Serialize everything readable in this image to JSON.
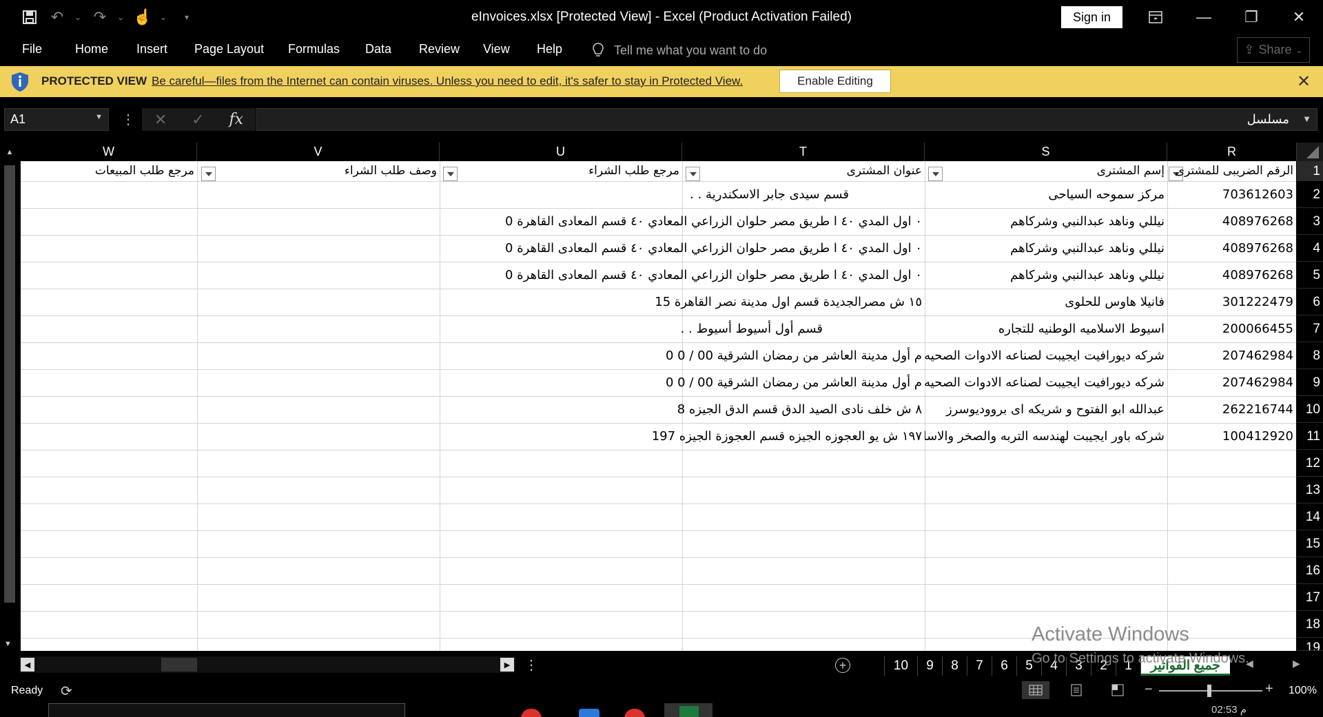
{
  "window": {
    "title": "eInvoices.xlsx  [Protected View]  -  Excel (Product Activation Failed)",
    "sign_in": "Sign in"
  },
  "ribbon": {
    "tabs": [
      "File",
      "Home",
      "Insert",
      "Page Layout",
      "Formulas",
      "Data",
      "Review",
      "View",
      "Help"
    ],
    "tell_me": "Tell me what you want to do",
    "share": "Share"
  },
  "protected_view": {
    "title": "PROTECTED VIEW",
    "message": "Be careful—files from the Internet can contain viruses. Unless you need to edit, it's safer to stay in Protected View.",
    "button": "Enable Editing"
  },
  "formula_bar": {
    "name_box": "A1",
    "fx": "fx",
    "value": "مسلسل"
  },
  "columns": [
    "W",
    "V",
    "U",
    "T",
    "S",
    "R"
  ],
  "header_row": {
    "W": "مرجع طلب المبيعات",
    "V": "وصف طلب الشراء",
    "U": "مرجع طلب الشراء",
    "T": "عنوان المشترى",
    "S": "إسم المشترى",
    "R": "الرقم الضريبى للمشترى"
  },
  "rows": [
    {
      "num": "2",
      "R": "703612603",
      "S": "مركز سموحه السياحى",
      "T": "قسم  سيدى جابر الاسكندرية . ."
    },
    {
      "num": "3",
      "R": "408976268",
      "S": "نيللي وناهد عبدالنبي وشركاهم",
      "T": "٠ اول المدي ٤٠ ا طريق مصر حلوان الزراعي المعادي ٤٠ قسم المعادى القاهرة 0"
    },
    {
      "num": "4",
      "R": "408976268",
      "S": "نيللي وناهد عبدالنبي وشركاهم",
      "T": "٠ اول المدي ٤٠ ا طريق مصر حلوان الزراعي المعادي ٤٠ قسم المعادى القاهرة 0"
    },
    {
      "num": "5",
      "R": "408976268",
      "S": "نيللي وناهد عبدالنبي وشركاهم",
      "T": "٠ اول المدي ٤٠ ا طريق مصر حلوان الزراعي المعادي ٤٠ قسم المعادى القاهرة 0"
    },
    {
      "num": "6",
      "R": "301222479",
      "S": "فانيلا هاوس للحلوى",
      "T": "١٥  ش مصرالجديدة قسم اول مدينة نصر القاهرة  15"
    },
    {
      "num": "7",
      "R": "200066455",
      "S": "اسيوط الاسلاميه الوطنيه للتجاره",
      "T": "قسم أول أسيوط أسيوط . ."
    },
    {
      "num": "8",
      "R": "207462984",
      "S": "شركه ديورافيت ايجيبت لصناعه الادوات الصحيه",
      "T": "م أول مدينة العاشر من رمضان الشرقية 00 / 0 0"
    },
    {
      "num": "9",
      "R": "207462984",
      "S": "شركه ديورافيت ايجيبت لصناعه الادوات الصحيه",
      "T": "م أول مدينة العاشر من رمضان الشرقية 00 / 0 0"
    },
    {
      "num": "10",
      "R": "262216744",
      "S": "عبدالله ابو الفتوح و شريكه اى برووديوسرز",
      "T": "٨   ش خلف نادى الصيد الدق قسم الدق الجيزه    8"
    },
    {
      "num": "11",
      "R": "100412920",
      "S": "شركه باور ايجيبت لهندسه التربه والصخر والاساس",
      "T": "١٩٧ ش يو العجوزه الجيزه  قسم العجوزة الجيزه 197"
    }
  ],
  "empty_rows": [
    "12",
    "13",
    "14",
    "15",
    "16",
    "17",
    "18",
    "19"
  ],
  "watermark": {
    "line1": "Activate Windows",
    "line2": "Go to Settings to activate Windows."
  },
  "sheet_tabs": [
    "10",
    "9",
    "8",
    "7",
    "6",
    "5",
    "4",
    "3",
    "2",
    "1",
    "جميع الفواتير"
  ],
  "status": {
    "ready": "Ready",
    "zoom": "100%"
  },
  "clock": "02:53 م",
  "colors": {
    "protected_bar": "#f1d15e",
    "active_tab_text": "#1b6a2e",
    "excel_green": "#1b7a3c"
  }
}
